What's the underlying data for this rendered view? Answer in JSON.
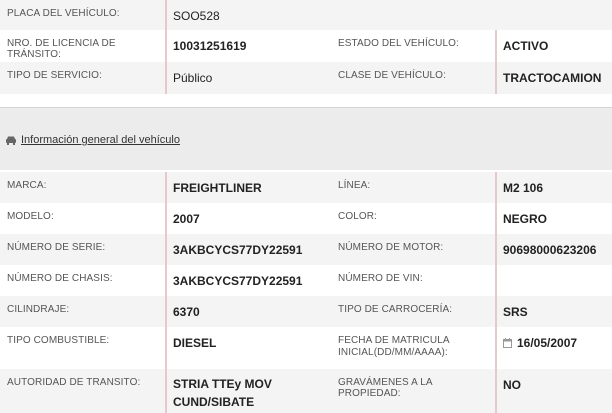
{
  "top": {
    "rows": [
      {
        "label1": "PLACA DEL VEHÍCULO:",
        "value1": "SOO528"
      },
      {
        "label1": "NRO. DE LICENCIA DE TRÁNSITO:",
        "value1": "10031251619",
        "label2": "ESTADO DEL VEHÍCULO:",
        "value2": "ACTIVO"
      },
      {
        "label1": "TIPO DE SERVICIO:",
        "value1": "Público",
        "label2": "CLASE DE VEHÍCULO:",
        "value2": "TRACTOCAMION"
      }
    ]
  },
  "section": {
    "icon": "car-icon",
    "title": "Información general del vehículo"
  },
  "details": {
    "marca_label": "MARCA:",
    "marca": "FREIGHTLINER",
    "linea_label": "LÍNEA:",
    "linea": "M2 106",
    "modelo_label": "MODELO:",
    "modelo": "2007",
    "color_label": "COLOR:",
    "color": "NEGRO",
    "serie_label": "NÚMERO DE SERIE:",
    "serie": "3AKBCYCS77DY22591",
    "motor_label": "NÚMERO DE MOTOR:",
    "motor": "90698000623206",
    "chasis_label": "NÚMERO DE CHASIS:",
    "chasis": "3AKBCYCS77DY22591",
    "vin_label": "NÚMERO DE VIN:",
    "vin": "",
    "cilindraje_label": "CILINDRAJE:",
    "cilindraje": "6370",
    "carroceria_label": "TIPO DE CARROCERÍA:",
    "carroceria": "SRS",
    "combustible_label": "TIPO COMBUSTIBLE:",
    "combustible": "DIESEL",
    "matricula_label_1": "FECHA DE MATRICULA",
    "matricula_label_2": "INICIAL(DD/MM/AAAA):",
    "matricula": "16/05/2007",
    "autoridad_label": "AUTORIDAD DE TRANSITO:",
    "autoridad_1": "STRIA TTEy MOV",
    "autoridad_2": "CUND/SIBATE",
    "gravamenes_label": "GRAVÁMENES A LA PROPIEDAD:",
    "gravamenes": "NO"
  },
  "colors": {
    "row_alt": "#f4f4f4",
    "value_border": "#e7c9c9",
    "band": "#ececec"
  }
}
